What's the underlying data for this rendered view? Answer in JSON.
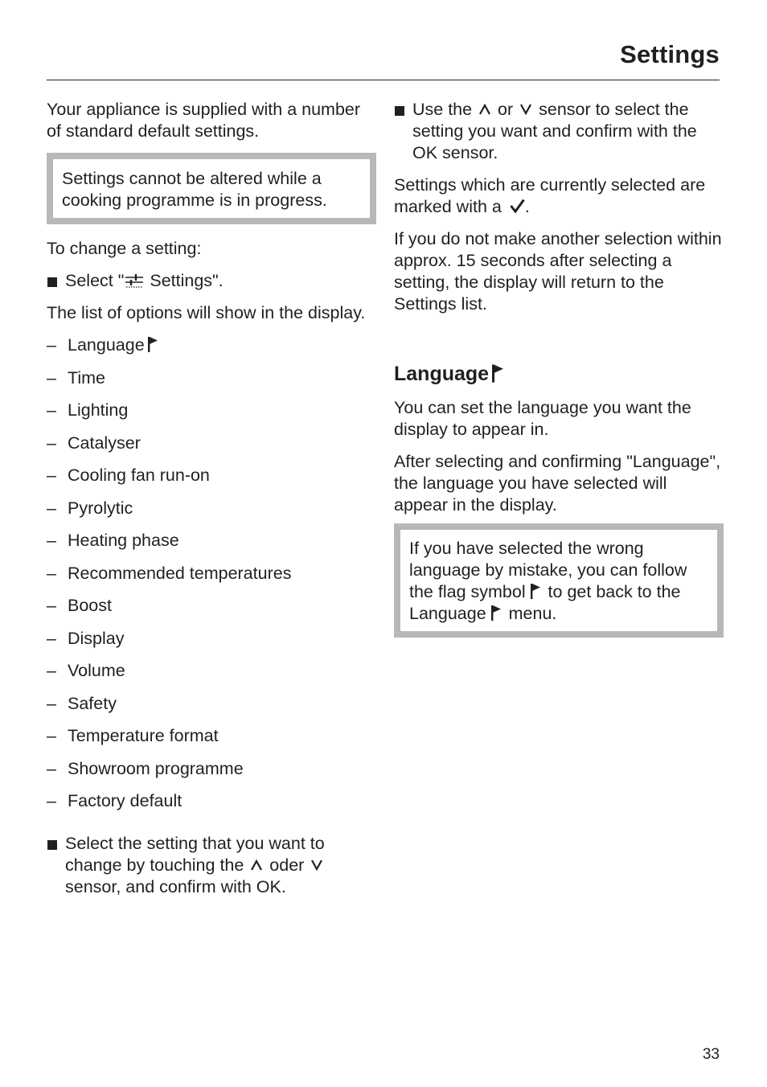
{
  "header": {
    "title": "Settings"
  },
  "left": {
    "intro": "Your appliance is supplied with a number of standard default settings.",
    "note": "Settings cannot be altered while a cooking programme is in progress.",
    "to_change": "To change a setting:",
    "step1_prefix": "Select \"",
    "step1_icon": "settings-sliders-icon",
    "step1_suffix": " Settings\".",
    "list_intro": "The list of options will show in the display.",
    "options": [
      "Language",
      "Time",
      "Lighting",
      "Catalyser",
      "Cooling fan run-on",
      "Pyrolytic",
      "Heating phase",
      "Recommended temperatures",
      "Boost",
      "Display",
      "Volume",
      "Safety",
      "Temperature format",
      "Showroom programme",
      "Factory default"
    ],
    "dash": "–",
    "step2_a": "Select the setting that you want to change by touching the ",
    "step2_b": " oder ",
    "step2_c": " sensor, and confirm with OK."
  },
  "right": {
    "step_a": "Use the ",
    "step_b": " or ",
    "step_c": " sensor to select the setting you want and confirm with the OK sensor.",
    "selected_a": "Settings which are currently selected are marked with a ",
    "selected_b": ".",
    "timeout": "If you do not make another selection within approx. 15 seconds after selecting a setting, the display will return to the Settings list.",
    "section_title": "Language",
    "section_p1": "You can set the language you want the display to appear in.",
    "section_p2": "After selecting and confirming \"Language\", the language you have selected will appear in the display.",
    "note_a": "If you have selected the wrong language by mistake, you can follow the flag symbol ",
    "note_b": " to get  back to the Language ",
    "note_c": " menu."
  },
  "footer": {
    "page_number": "33"
  }
}
